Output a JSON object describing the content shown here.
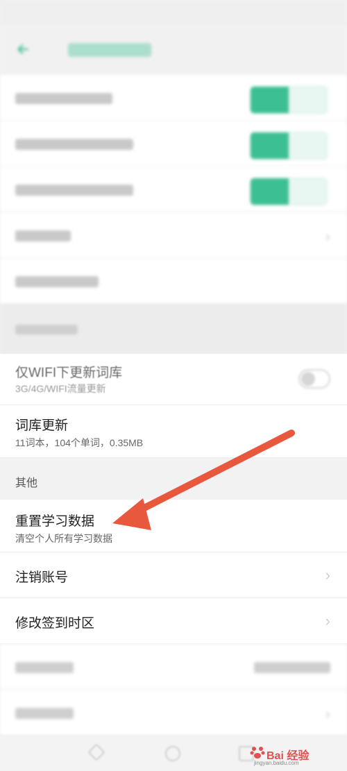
{
  "sections": {
    "other_header": "其他"
  },
  "items": {
    "wifi_update": {
      "label": "仅WIFI下更新词库",
      "desc": "3G/4G/WIFI流量更新"
    },
    "library_update": {
      "label": "词库更新",
      "desc": "11词本，104个单词，0.35MB"
    },
    "reset_data": {
      "label": "重置学习数据",
      "desc": "清空个人所有学习数据"
    },
    "logout": {
      "label": "注销账号"
    },
    "modify_timezone": {
      "label": "修改签到时区"
    }
  },
  "watermark": {
    "text": "Bai 经验",
    "url": "jingyan.baidu.com"
  },
  "colors": {
    "accent": "#3cbf93",
    "arrow": "#e8583d"
  }
}
